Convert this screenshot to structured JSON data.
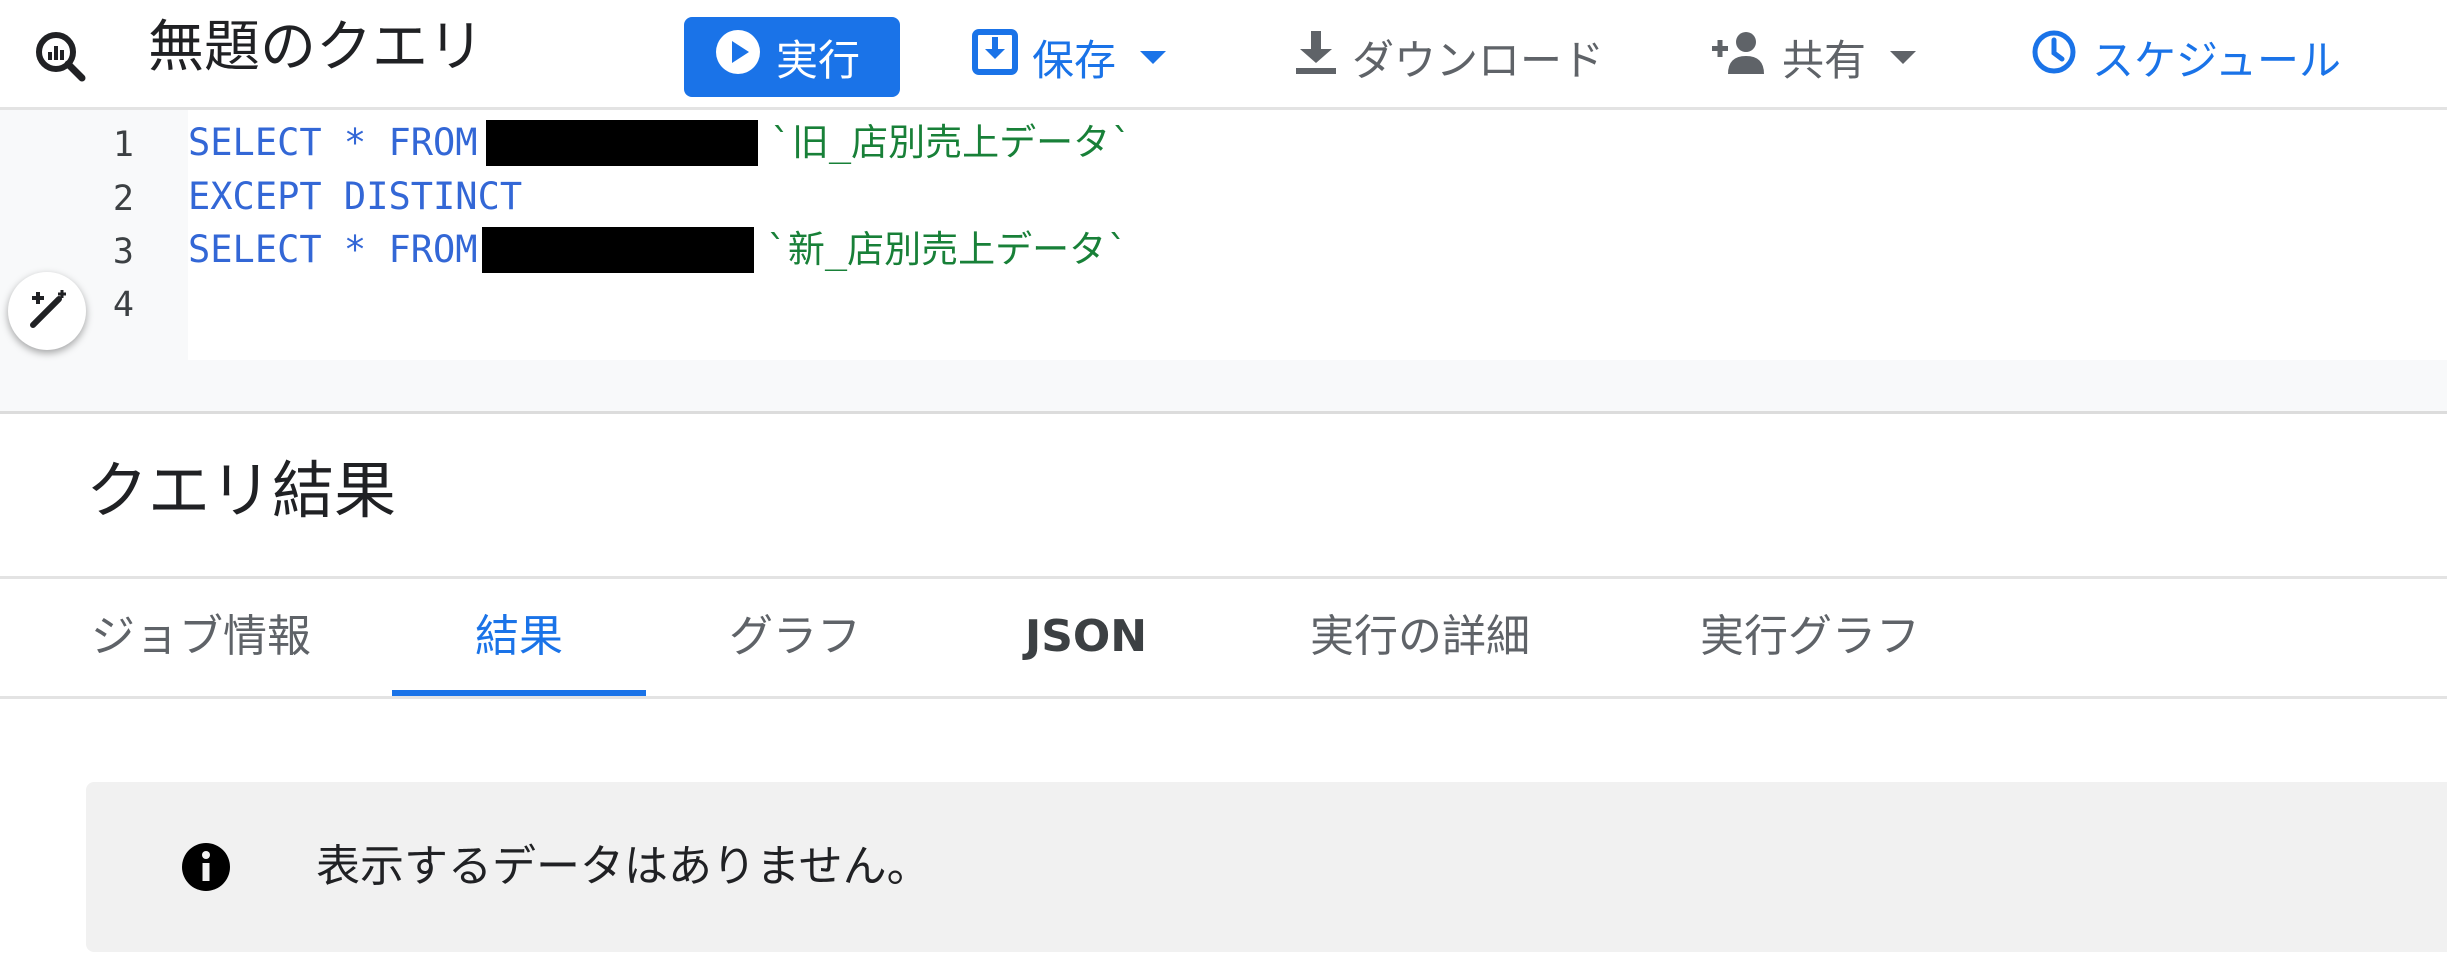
{
  "toolbar": {
    "title": "無題のクエリ",
    "run_label": "実行",
    "save_label": "保存",
    "download_label": "ダウンロード",
    "share_label": "共有",
    "schedule_label": "スケジュール"
  },
  "editor": {
    "line_numbers": [
      "1",
      "2",
      "3",
      "4"
    ],
    "lines": [
      {
        "keyword": "SELECT * FROM",
        "table": "`旧_店別売上データ`"
      },
      {
        "keyword": "EXCEPT DISTINCT",
        "table": ""
      },
      {
        "keyword": "SELECT * FROM",
        "table": "`新_店別売上データ`"
      },
      {
        "keyword": "",
        "table": ""
      }
    ]
  },
  "results": {
    "title": "クエリ結果",
    "tabs": [
      "ジョブ情報",
      "結果",
      "グラフ",
      "JSON",
      "実行の詳細",
      "実行グラフ"
    ],
    "active_tab": "結果",
    "message": "表示するデータはありません。"
  },
  "colors": {
    "accent": "#1a73e8",
    "keyword": "#3367d6",
    "string": "#188038"
  }
}
